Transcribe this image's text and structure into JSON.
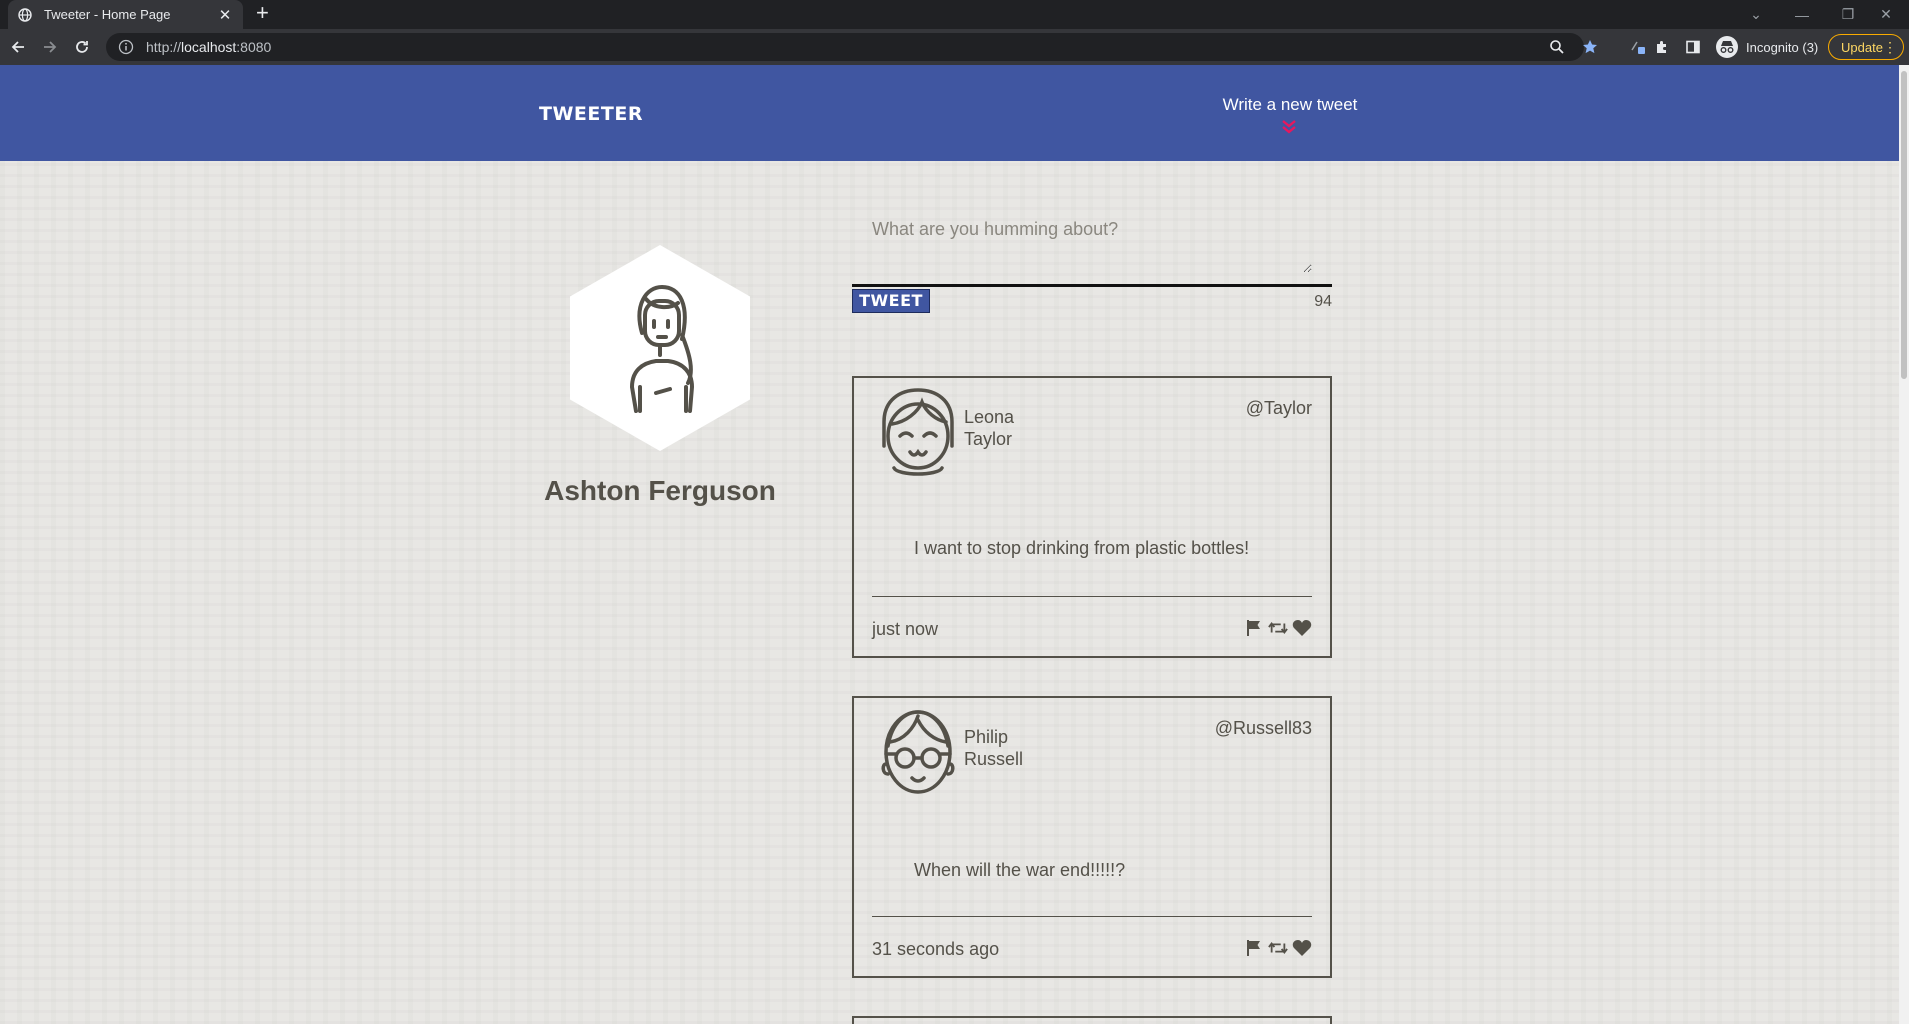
{
  "browser": {
    "tab_title": "Tweeter - Home Page",
    "tab_close": "✕",
    "new_tab": "+",
    "url_prefix": "http://",
    "url_host": "localhost",
    "url_port": ":8080",
    "profile_label": "Incognito (3)",
    "update_label": "Update",
    "menu_dots": "⋮",
    "window_controls": [
      "⌄",
      "—",
      "❐",
      "✕"
    ]
  },
  "nav": {
    "brand": "TWEETER",
    "compose_link": "Write a new tweet",
    "background": "#4056a1",
    "accent": "#e8175d"
  },
  "profile": {
    "name": "Ashton Ferguson"
  },
  "compose": {
    "placeholder": "What are you humming about?",
    "button_label": "TWEET",
    "char_count": "94"
  },
  "tweets": [
    {
      "first_name": "Leona",
      "last_name": "Taylor",
      "handle": "@Taylor",
      "content": "I want to stop drinking from plastic bottles!",
      "time": "just now",
      "avatar_icon": "smiling-girl-avatar-icon"
    },
    {
      "first_name": "Philip",
      "last_name": "Russell",
      "handle": "@Russell83",
      "content": "When will the war end!!!!!?",
      "time": "31 seconds ago",
      "avatar_icon": "glasses-boy-avatar-icon"
    }
  ]
}
